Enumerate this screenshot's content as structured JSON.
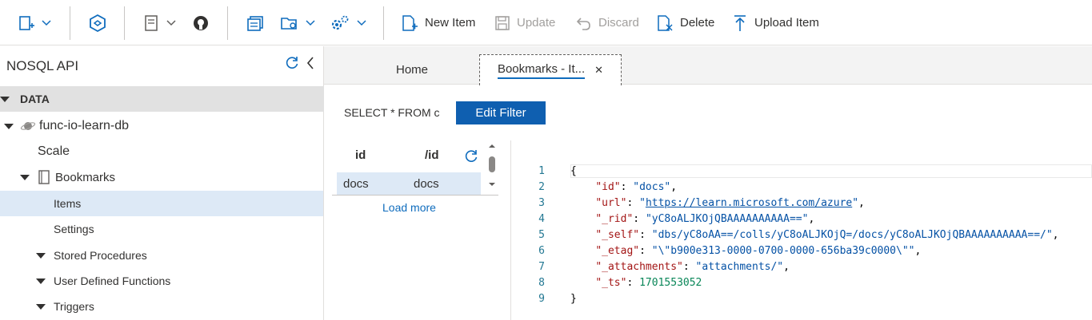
{
  "toolbar": {
    "new_item": "New Item",
    "update": "Update",
    "discard": "Discard",
    "delete": "Delete",
    "upload_item": "Upload Item"
  },
  "sidebar": {
    "title": "NOSQL API",
    "section": "DATA",
    "database": "func-io-learn-db",
    "scale": "Scale",
    "container": "Bookmarks",
    "items": "Items",
    "settings": "Settings",
    "stored_procedures": "Stored Procedures",
    "udfs": "User Defined Functions",
    "triggers": "Triggers"
  },
  "tabs": {
    "home": "Home",
    "active": "Bookmarks - It...",
    "close": "✕"
  },
  "filter": {
    "query": "SELECT * FROM c",
    "edit_button": "Edit Filter"
  },
  "grid": {
    "col_id": "id",
    "col_pk": "/id",
    "rows": [
      {
        "id": "docs",
        "pk": "docs"
      }
    ],
    "load_more": "Load more"
  },
  "editor": {
    "line_numbers": [
      "1",
      "2",
      "3",
      "4",
      "5",
      "6",
      "7",
      "8",
      "9"
    ],
    "open_brace": "{",
    "close_brace": "}",
    "fields": {
      "id_key": "\"id\"",
      "id_val": "\"docs\"",
      "url_key": "\"url\"",
      "url_val": "https://learn.microsoft.com/azure",
      "rid_key": "\"_rid\"",
      "rid_val": "\"yC8oALJKOjQBAAAAAAAAAA==\"",
      "self_key": "\"_self\"",
      "self_val": "\"dbs/yC8oAA==/colls/yC8oALJKOjQ=/docs/yC8oALJKOjQBAAAAAAAAAA==/\"",
      "etag_key": "\"_etag\"",
      "etag_val": "\"\\\"b900e313-0000-0700-0000-656ba39c0000\\\"\"",
      "attachments_key": "\"_attachments\"",
      "attachments_val": "\"attachments/\"",
      "ts_key": "\"_ts\"",
      "ts_val": "1701553052"
    }
  },
  "colors": {
    "accent": "#0f6cbd",
    "button_bg": "#0f5fb0",
    "selected_row": "#dde9f6"
  },
  "icons": [
    "new-container-icon",
    "cosmos-icon",
    "notebook-icon",
    "github-icon",
    "new-query-icon",
    "open-folder-icon",
    "settings-gear-icon",
    "new-item-icon",
    "save-icon",
    "discard-icon",
    "delete-icon",
    "upload-icon",
    "refresh-icon",
    "collapse-icon",
    "planet-icon",
    "container-icon",
    "close-icon"
  ]
}
